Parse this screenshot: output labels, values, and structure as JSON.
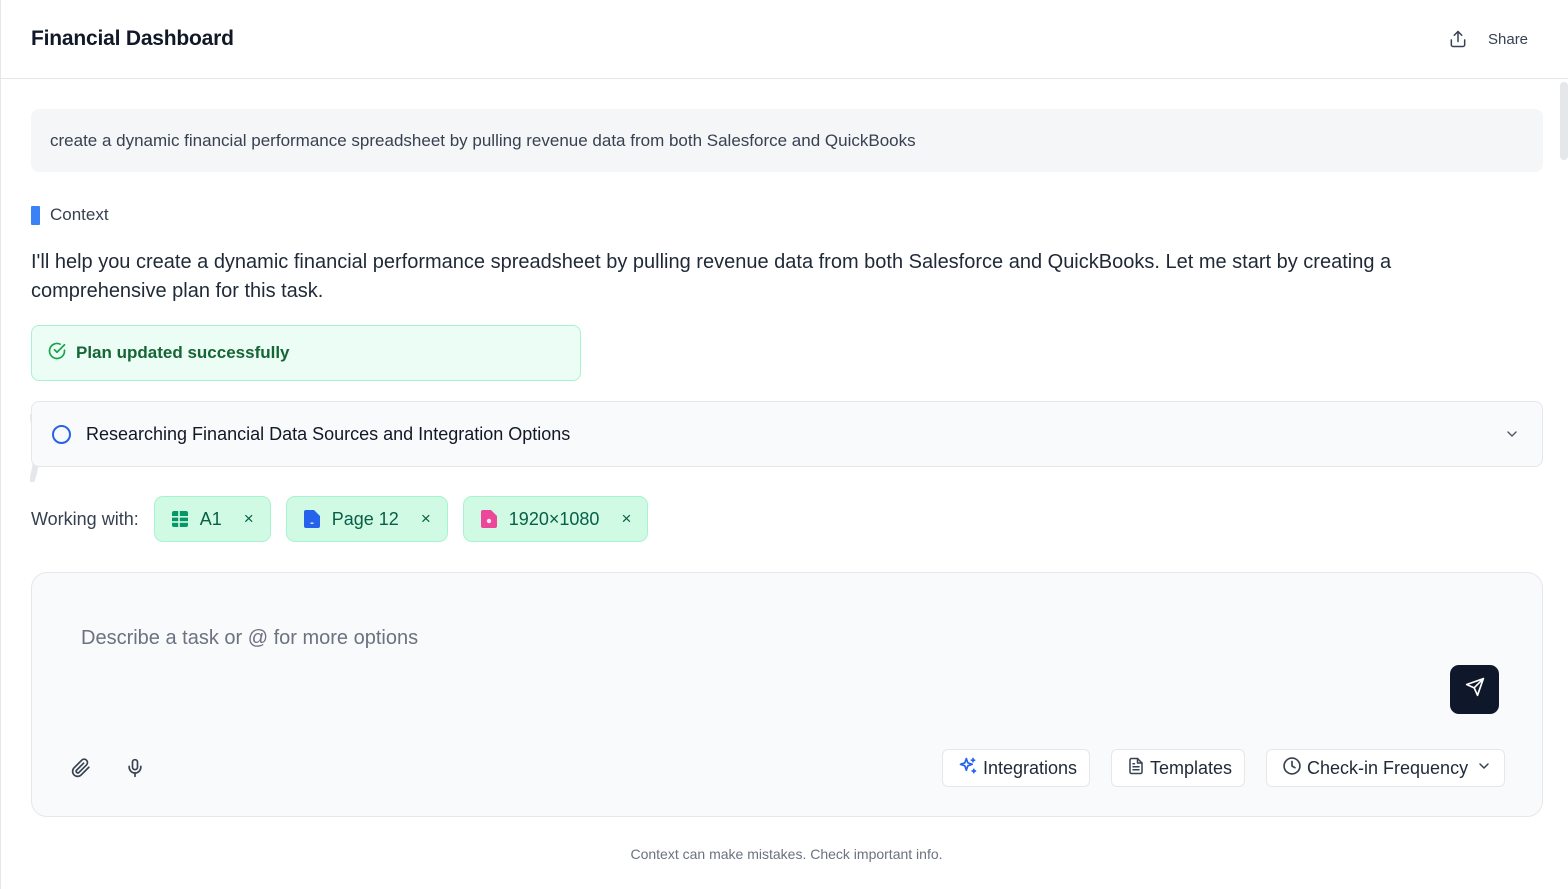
{
  "header": {
    "title": "Financial Dashboard",
    "share_label": "Share",
    "share_icon": "upload-share-icon"
  },
  "user_message": {
    "text": "create a dynamic financial performance spreadsheet by pulling revenue data from both Salesforce and QuickBooks"
  },
  "assistant": {
    "name": "Context",
    "accent_color": "#3b82f6",
    "message": "I'll help you create a dynamic financial performance spreadsheet by pulling revenue data from both Salesforce and QuickBooks. Let me start by creating a comprehensive plan for this task."
  },
  "status": {
    "label": "Plan updated successfully",
    "icon": "check-circle-icon",
    "color": "#16a34a"
  },
  "task": {
    "label": "Researching Financial Data Sources and Integration Options",
    "icon": "circle-icon",
    "expand_icon": "chevron-down-icon"
  },
  "working_with": {
    "label": "Working with:",
    "chips": [
      {
        "label": "A1",
        "icon": "spreadsheet-icon",
        "icon_color": "#059669",
        "remove": "×"
      },
      {
        "label": "Page 12",
        "icon": "document-icon",
        "icon_color": "#2563eb",
        "remove": "×"
      },
      {
        "label": "1920×1080",
        "icon": "image-file-icon",
        "icon_color": "#ec4899",
        "remove": "×"
      }
    ]
  },
  "composer": {
    "placeholder": "Describe a task or @ for more options",
    "value": "",
    "send_icon": "send-icon",
    "attach_icon": "paperclip-icon",
    "mic_icon": "microphone-icon",
    "buttons": {
      "integrations": "Integrations",
      "templates": "Templates",
      "checkin": "Check-in Frequency"
    }
  },
  "footer": {
    "note": "Context can make mistakes. Check important info."
  }
}
